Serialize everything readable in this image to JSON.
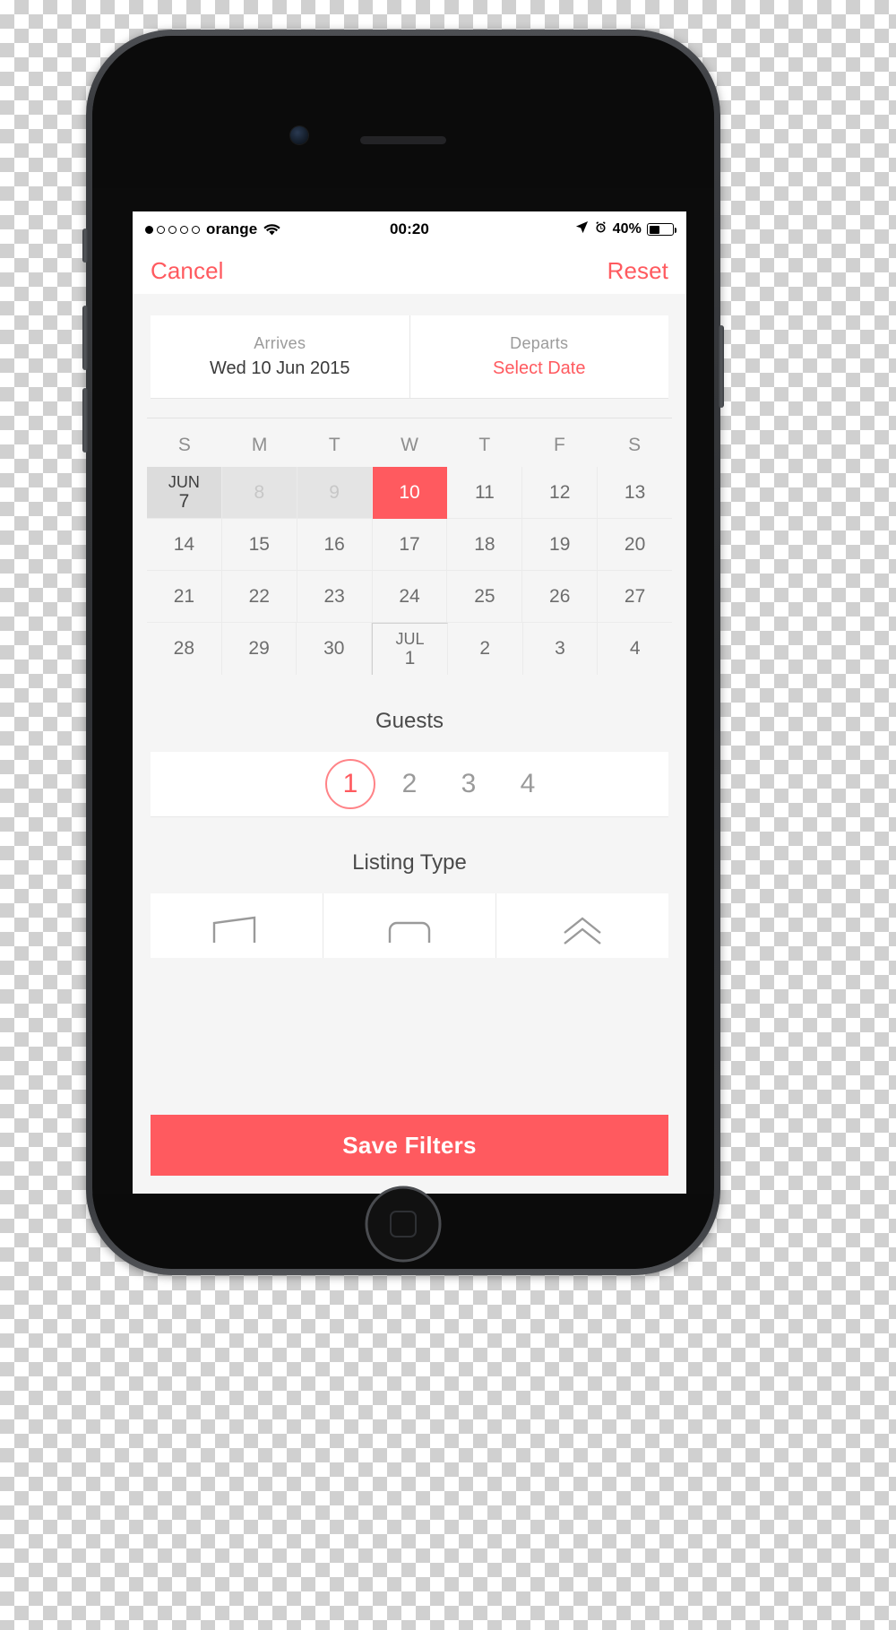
{
  "device": {
    "name": "iphone-6-space-gray"
  },
  "status_bar": {
    "signal_dots": [
      true,
      false,
      false,
      false,
      false
    ],
    "carrier": "orange",
    "wifi_icon": "wifi-icon",
    "time": "00:20",
    "location_icon": "location-arrow-icon",
    "alarm_icon": "alarm-clock-icon",
    "battery_percent": "40%",
    "battery_level": 40
  },
  "navbar": {
    "cancel_label": "Cancel",
    "reset_label": "Reset",
    "accent_color": "#ff5a5f"
  },
  "date_summary": {
    "arrives": {
      "label": "Arrives",
      "value": "Wed 10 Jun 2015",
      "is_placeholder": false
    },
    "departs": {
      "label": "Departs",
      "value": "Select Date",
      "is_placeholder": true
    }
  },
  "calendar": {
    "weekdays": [
      "S",
      "M",
      "T",
      "W",
      "T",
      "F",
      "S"
    ],
    "rows": [
      [
        {
          "day": "7",
          "month": "JUN",
          "state": "month-start"
        },
        {
          "day": "8",
          "state": "disabled"
        },
        {
          "day": "9",
          "state": "disabled"
        },
        {
          "day": "10",
          "state": "selected"
        },
        {
          "day": "11",
          "state": "normal"
        },
        {
          "day": "12",
          "state": "normal"
        },
        {
          "day": "13",
          "state": "normal"
        }
      ],
      [
        {
          "day": "14",
          "state": "normal"
        },
        {
          "day": "15",
          "state": "normal"
        },
        {
          "day": "16",
          "state": "normal"
        },
        {
          "day": "17",
          "state": "normal"
        },
        {
          "day": "18",
          "state": "normal"
        },
        {
          "day": "19",
          "state": "normal"
        },
        {
          "day": "20",
          "state": "normal"
        }
      ],
      [
        {
          "day": "21",
          "state": "normal"
        },
        {
          "day": "22",
          "state": "normal"
        },
        {
          "day": "23",
          "state": "normal"
        },
        {
          "day": "24",
          "state": "normal"
        },
        {
          "day": "25",
          "state": "normal"
        },
        {
          "day": "26",
          "state": "normal"
        },
        {
          "day": "27",
          "state": "normal"
        }
      ],
      [
        {
          "day": "28",
          "state": "normal"
        },
        {
          "day": "29",
          "state": "normal"
        },
        {
          "day": "30",
          "state": "normal"
        },
        {
          "day": "1",
          "month": "JUL",
          "state": "month-break"
        },
        {
          "day": "2",
          "state": "normal"
        },
        {
          "day": "3",
          "state": "normal"
        },
        {
          "day": "4",
          "state": "normal"
        }
      ]
    ]
  },
  "guests": {
    "title": "Guests",
    "options": [
      "1",
      "2",
      "3",
      "4"
    ],
    "selected": "1"
  },
  "listing_type": {
    "title": "Listing Type",
    "options": [
      {
        "icon": "entire-home-icon"
      },
      {
        "icon": "private-room-icon"
      },
      {
        "icon": "shared-room-icon"
      }
    ]
  },
  "footer": {
    "save_label": "Save Filters"
  }
}
